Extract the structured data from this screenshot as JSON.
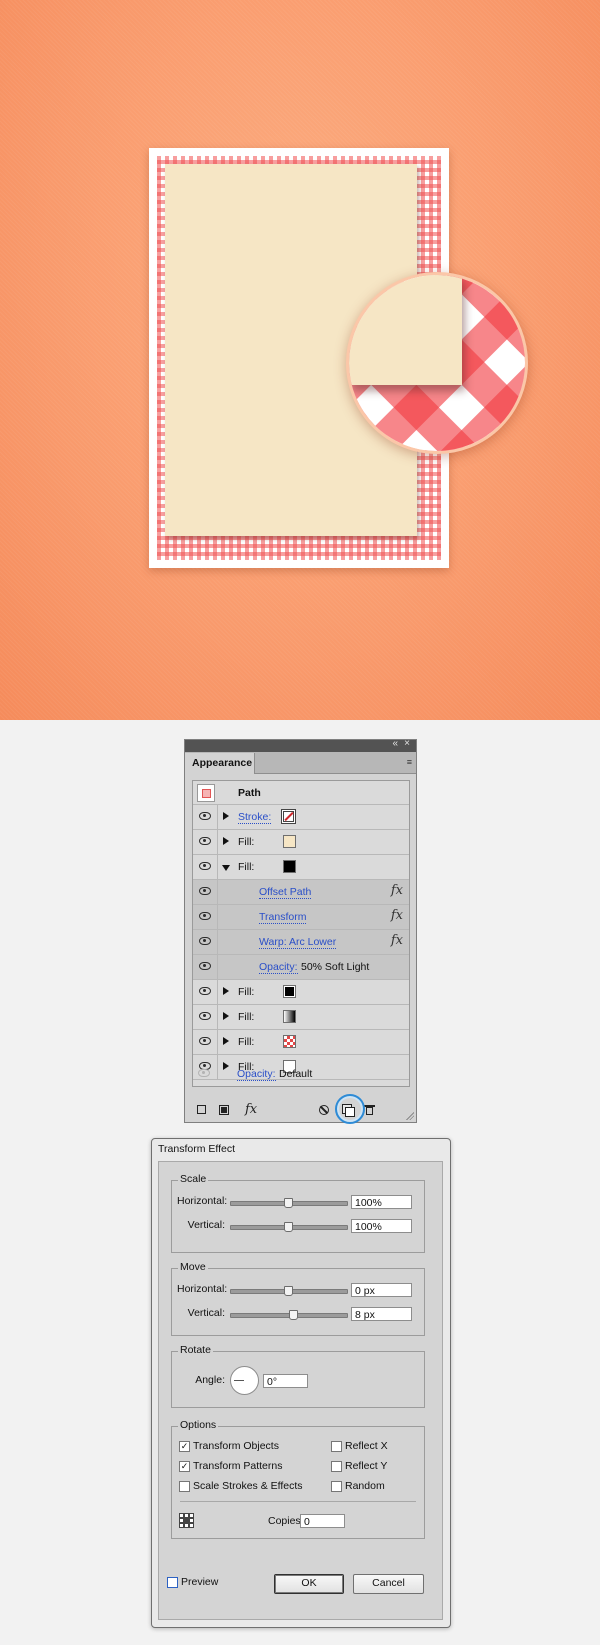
{
  "appearance_panel": {
    "tab_label": "Appearance",
    "collapse_glyph": "«",
    "close_glyph": "×",
    "menu_glyph": "≡",
    "target_label": "Path",
    "rows": [
      {
        "kind": "stroke",
        "label": "Stroke:",
        "swatch": "none-red-slash",
        "twirl": "closed"
      },
      {
        "kind": "fill",
        "label": "Fill:",
        "swatch": "#f6e6c5",
        "twirl": "closed"
      },
      {
        "kind": "fill",
        "label": "Fill:",
        "swatch": "#000000",
        "twirl": "open"
      },
      {
        "kind": "effect",
        "label": "Offset Path"
      },
      {
        "kind": "effect",
        "label": "Transform"
      },
      {
        "kind": "effect",
        "label": "Warp: Arc Lower"
      },
      {
        "kind": "opacity",
        "label": "Opacity:",
        "value": "50% Soft Light"
      },
      {
        "kind": "fill",
        "label": "Fill:",
        "swatch": "#000000",
        "twirl": "closed"
      },
      {
        "kind": "fill",
        "label": "Fill:",
        "swatch": "gradient",
        "twirl": "closed"
      },
      {
        "kind": "fill",
        "label": "Fill:",
        "swatch": "gingham",
        "twirl": "closed"
      },
      {
        "kind": "fill",
        "label": "Fill:",
        "swatch": "#ffffff",
        "twirl": "closed"
      },
      {
        "kind": "opacity-root",
        "label": "Opacity:",
        "value": "Default"
      }
    ],
    "fx_glyph": "fx",
    "toolbar": {
      "new_stroke_icon": "add-stroke-icon",
      "new_fill_icon": "add-fill-icon",
      "fx_label": "fx",
      "clear_icon": "clear-appearance-icon",
      "duplicate_icon": "duplicate-item-icon",
      "delete_icon": "trash-icon"
    }
  },
  "transform_dialog": {
    "title": "Transform Effect",
    "scale": {
      "legend": "Scale",
      "horizontal_label": "Horizontal:",
      "horizontal_value": "100%",
      "horizontal_slider": 0.5,
      "vertical_label": "Vertical:",
      "vertical_value": "100%",
      "vertical_slider": 0.5
    },
    "move": {
      "legend": "Move",
      "horizontal_label": "Horizontal:",
      "horizontal_value": "0 px",
      "horizontal_slider": 0.5,
      "vertical_label": "Vertical:",
      "vertical_value": "8 px",
      "vertical_slider": 0.54
    },
    "rotate": {
      "legend": "Rotate",
      "angle_label": "Angle:",
      "angle_value": "0°"
    },
    "options": {
      "legend": "Options",
      "transform_objects": {
        "label": "Transform Objects",
        "checked": true
      },
      "transform_patterns": {
        "label": "Transform Patterns",
        "checked": true
      },
      "scale_strokes": {
        "label": "Scale Strokes & Effects",
        "checked": false
      },
      "reflect_x": {
        "label": "Reflect X",
        "checked": false
      },
      "reflect_y": {
        "label": "Reflect Y",
        "checked": false
      },
      "random": {
        "label": "Random",
        "checked": false
      },
      "copies_label": "Copies",
      "copies_value": "0"
    },
    "preview_label": "Preview",
    "ok_label": "OK",
    "cancel_label": "Cancel"
  },
  "colors": {
    "background": "#f99a6c",
    "gingham_red": "#f05050",
    "paper": "#f6e6c5",
    "link_blue": "#2a4fc8",
    "highlight_ring": "#2d8bd6"
  }
}
